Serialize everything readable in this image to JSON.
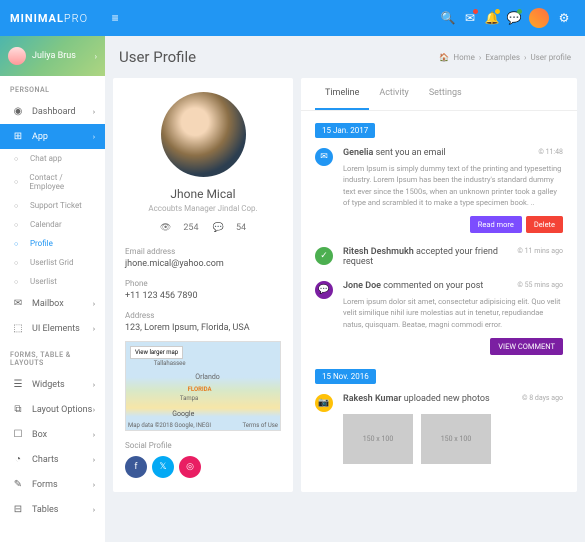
{
  "brand": {
    "a": "MINIMAL",
    "b": "PRO"
  },
  "user": {
    "name": "Juliya Brus"
  },
  "sections": {
    "personal": "PERSONAL",
    "forms": "FORMS, TABLE & LAYOUTS"
  },
  "nav": {
    "dashboard": "Dashboard",
    "app": "App",
    "chat": "Chat app",
    "contact": "Contact / Employee",
    "support": "Support Ticket",
    "calendar": "Calendar",
    "profile": "Profile",
    "userlistgrid": "Userlist Grid",
    "userlist": "Userlist",
    "mailbox": "Mailbox",
    "uielements": "UI Elements",
    "widgets": "Widgets",
    "layoutopts": "Layout Options",
    "box": "Box",
    "charts": "Charts",
    "forms": "Forms",
    "tables": "Tables"
  },
  "page": {
    "title": "User Profile"
  },
  "crumbs": {
    "home": "Home",
    "examples": "Examples",
    "current": "User profile"
  },
  "profile": {
    "name": "Jhone Mical",
    "role": "Accoubts Manager Jindal Cop.",
    "stat1": "254",
    "stat2": "54",
    "emailLabel": "Email address",
    "email": "jhone.mical@yahoo.com",
    "phoneLabel": "Phone",
    "phone": "+11 123 456 7890",
    "addressLabel": "Address",
    "address": "123, Lorem Ipsum, Florida, USA",
    "mapBtn": "View larger map",
    "mapCredit": "Map data ©2018 Google, INEGI",
    "mapTerms": "Terms of Use",
    "mapLogo": "Google",
    "socialLabel": "Social Profile"
  },
  "tabs": {
    "timeline": "Timeline",
    "activity": "Activity",
    "settings": "Settings"
  },
  "timeline": {
    "date1": "15 Jan. 2017",
    "i1": {
      "name": "Genelia",
      "action": " sent you an email",
      "time": "© 11:48",
      "text": "Lorem Ipsum is simply dummy text of the printing and typesetting industry. Lorem Ipsum has been the industry's standard dummy text ever since the 1500s, when an unknown printer took a galley of type and scrambled it to make a type specimen book. ..",
      "readmore": "Read more",
      "delete": "Delete"
    },
    "i2": {
      "name": "Ritesh Deshmukh",
      "action": " accepted your friend request",
      "time": "© 11 mins ago"
    },
    "i3": {
      "name": "Jone Doe",
      "action": " commented on your post",
      "time": "© 55 mins ago",
      "text": "Lorem ipsum dolor sit amet, consectetur adipisicing elit. Quo velit velit similique nihil iure molestias aut in tenetur, repudiandae natus, quisquam. Beatae, magni commodi error.",
      "btn": "VIEW COMMENT"
    },
    "date2": "15 Nov. 2016",
    "i4": {
      "name": "Rakesh Kumar",
      "action": " uploaded new photos",
      "time": "© 8 days ago",
      "photo": "150 x 100"
    }
  },
  "colors": {
    "blue": "#2196F3",
    "green": "#4CAF50",
    "purple": "#7B1FA2",
    "yellow": "#FFC107",
    "red": "#F44336",
    "violet": "#7C4DFF",
    "pink": "#E91E63",
    "twitter": "#03A9F4",
    "fb": "#3b5998"
  }
}
